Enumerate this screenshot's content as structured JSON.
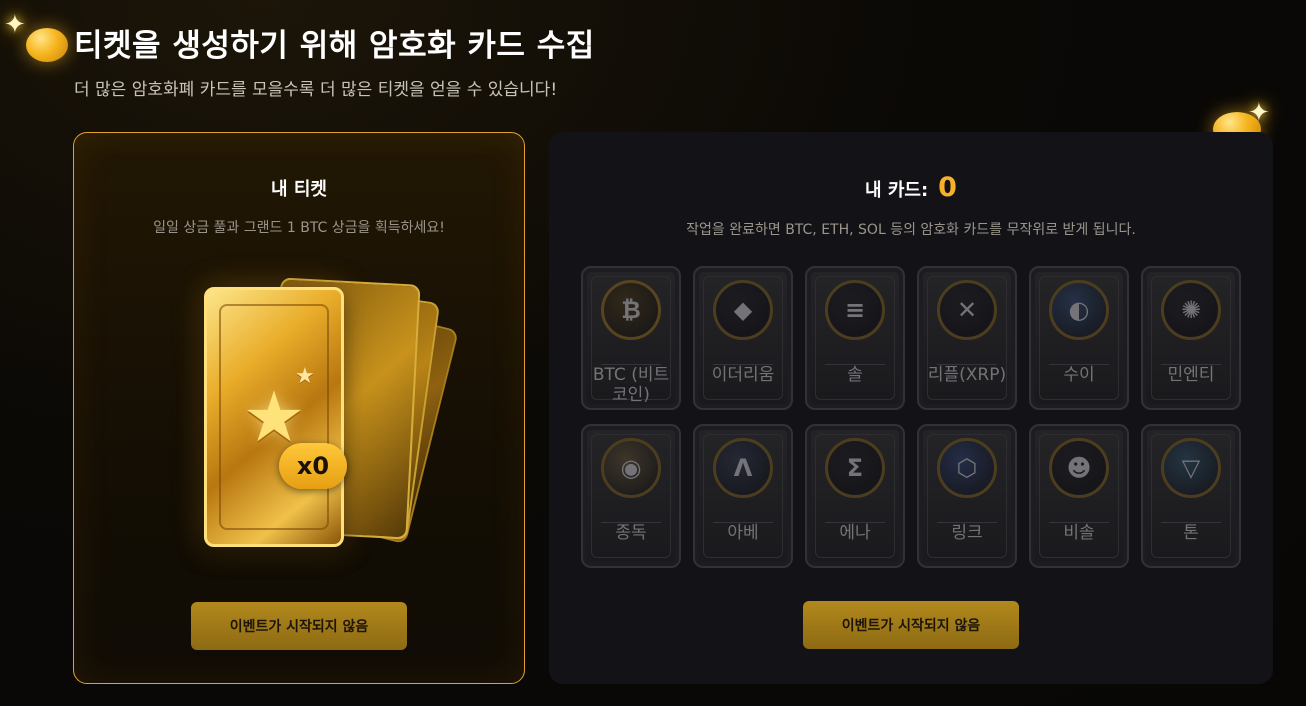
{
  "header": {
    "title": "티켓을 생성하기 위해 암호화 카드 수집",
    "subtitle": "더 많은 암호화폐 카드를 모을수록 더 많은 티켓을 얻을 수 있습니다!"
  },
  "tickets": {
    "title": "내 티켓",
    "description": "일일 상금 풀과 그랜드 1 BTC 상금을 획득하세요!",
    "count": "x0",
    "button": "이벤트가 시작되지 않음"
  },
  "cards": {
    "title": "내 카드:",
    "count": "0",
    "description": "작업을 완료하면 BTC, ETH, SOL 등의 암호화 카드를 무작위로 받게 됩니다.",
    "button": "이벤트가 시작되지 않음",
    "items": [
      {
        "label": "BTC (비트코인)",
        "icon": "bitcoin-icon",
        "glyph": "₿",
        "ring": "#6a5420",
        "bg": "#3a2f1a"
      },
      {
        "label": "이더리움",
        "icon": "ethereum-icon",
        "glyph": "◆",
        "ring": "#5c4a20",
        "bg": "#1e1e24"
      },
      {
        "label": "솔",
        "icon": "solana-icon",
        "glyph": "≡",
        "ring": "#5c4a20",
        "bg": "#1e1e24"
      },
      {
        "label": "리플(XRP)",
        "icon": "xrp-icon",
        "glyph": "✕",
        "ring": "#5c4a20",
        "bg": "#1e1e24"
      },
      {
        "label": "수이",
        "icon": "sui-icon",
        "glyph": "◐",
        "ring": "#5c4a20",
        "bg": "#2a3a55"
      },
      {
        "label": "민엔티",
        "icon": "mint-icon",
        "glyph": "✺",
        "ring": "#5c4a20",
        "bg": "#1e1e24"
      },
      {
        "label": "종독",
        "icon": "bonk-icon",
        "glyph": "◉",
        "ring": "#5c4a20",
        "bg": "#4a4030"
      },
      {
        "label": "아베",
        "icon": "aave-icon",
        "glyph": "Λ",
        "ring": "#5c4a20",
        "bg": "#2a2f3e"
      },
      {
        "label": "에나",
        "icon": "ethena-icon",
        "glyph": "Σ",
        "ring": "#5c4a20",
        "bg": "#1e1e24"
      },
      {
        "label": "링크",
        "icon": "chainlink-icon",
        "glyph": "⬡",
        "ring": "#5c4a20",
        "bg": "#2a3556"
      },
      {
        "label": "비솔",
        "icon": "bisol-icon",
        "glyph": "☻",
        "ring": "#5c4a20",
        "bg": "#1e1e24"
      },
      {
        "label": "톤",
        "icon": "ton-icon",
        "glyph": "▽",
        "ring": "#5c4a20",
        "bg": "#2a3e50"
      }
    ]
  },
  "colors": {
    "accent": "#f7b02a",
    "button": "#a07a18",
    "panel_border": "#e0a12e"
  }
}
